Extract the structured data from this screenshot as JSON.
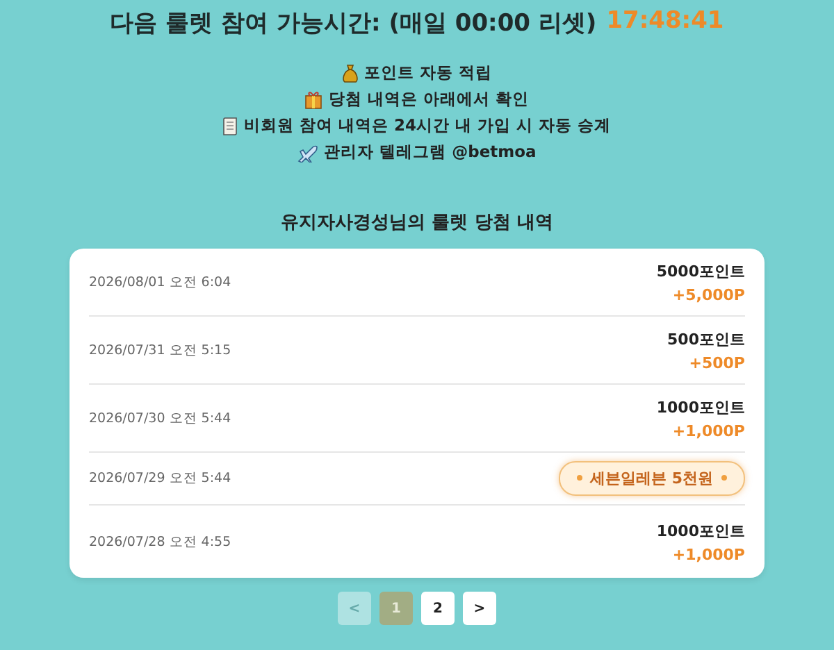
{
  "header": {
    "title": "다음 룰렛 참여 가능시간: (매일 00:00 리셋)",
    "countdown": "17:48:41"
  },
  "notices": [
    {
      "kind": "moneybag",
      "text": "포인트 자동 적립"
    },
    {
      "kind": "gift",
      "text": "당첨 내역은 아래에서 확인"
    },
    {
      "kind": "scroll",
      "text": "비회원 참여 내역은 24시간 내 가입 시 자동 승계"
    },
    {
      "kind": "plane",
      "text": "관리자 텔레그램 @betmoa"
    }
  ],
  "history_title": "유지자사경성님의 룰렛 당첨 내역",
  "rows": [
    {
      "kind": "points",
      "date": "2026/08/01 오전 6:04",
      "name": "5000포인트",
      "amount": "+5,000P"
    },
    {
      "kind": "points",
      "date": "2026/07/31 오전 5:15",
      "name": "500포인트",
      "amount": "+500P"
    },
    {
      "kind": "points",
      "date": "2026/07/30 오전 5:44",
      "name": "1000포인트",
      "amount": "+1,000P"
    },
    {
      "kind": "prize",
      "date": "2026/07/29 오전 5:44",
      "name": "세븐일레븐 5천원"
    },
    {
      "kind": "points",
      "date": "2026/07/28 오전 4:55",
      "name": "1000포인트",
      "amount": "+1,000P"
    }
  ],
  "pagination": [
    {
      "label": "<",
      "selected": false,
      "disabled": true
    },
    {
      "label": "1",
      "selected": true,
      "disabled": false
    },
    {
      "label": "2",
      "selected": false,
      "disabled": false
    },
    {
      "label": ">",
      "selected": false,
      "disabled": false
    }
  ]
}
